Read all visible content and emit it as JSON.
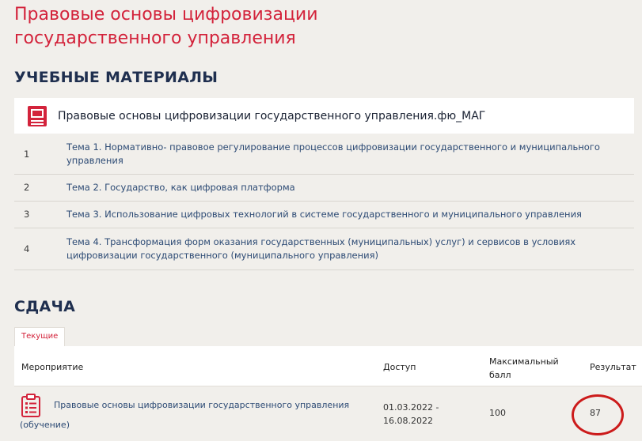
{
  "page": {
    "title": "Правовые основы цифровизации государственного управления"
  },
  "materials": {
    "heading": "УЧЕБНЫЕ МАТЕРИАЛЫ",
    "course_title": "Правовые основы цифровизации государственного управления.фю_МАГ",
    "course_icon": "book-icon",
    "topics": [
      {
        "num": "1",
        "text": "Тема 1. Нормативно- правовое регулирование процессов цифровизации государственного и муниципального управления"
      },
      {
        "num": "2",
        "text": "Тема 2. Государство, как цифровая платформа"
      },
      {
        "num": "3",
        "text": "Тема 3. Использование цифровых технологий в системе государственного и муниципального управления"
      },
      {
        "num": "4",
        "text": "Тема 4. Трансформация форм оказания государственных (муниципальных) услуг) и сервисов в условиях цифровизации государственного (муниципального управления)"
      }
    ]
  },
  "submission": {
    "heading": "СДАЧА",
    "tab_label": "Текущие",
    "columns": {
      "event": "Мероприятие",
      "access": "Доступ",
      "max_score": "Максимальный балл",
      "result": "Результат"
    },
    "rows": [
      {
        "icon": "checklist-icon",
        "title": "Правовые основы цифровизации государственного управления",
        "kind": "(обучение)",
        "access": "01.03.2022 - 16.08.2022",
        "max_score": "100",
        "result": "87"
      }
    ]
  },
  "colors": {
    "accent": "#d3233b",
    "heading": "#1f2f4f",
    "link": "#2c4a74",
    "background": "#f1efeb",
    "highlight_circle": "#cc1b1b"
  }
}
